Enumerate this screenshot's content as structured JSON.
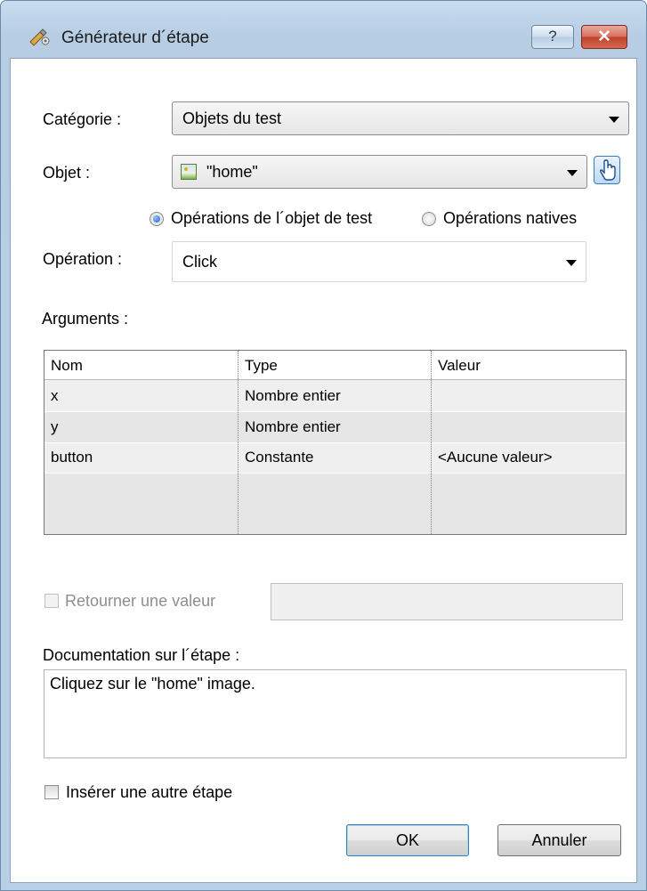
{
  "window": {
    "title": "Générateur d´étape",
    "help_label": "?",
    "close_label": "✕"
  },
  "category": {
    "label": "Catégorie :",
    "value": "Objets du test"
  },
  "object": {
    "label": "Objet :",
    "value": "\"home\"",
    "icon": "image-icon",
    "picker_icon": "pointing-hand-icon"
  },
  "operation_type": {
    "options": [
      {
        "label": "Opérations de l´objet de test",
        "selected": true
      },
      {
        "label": "Opérations natives",
        "selected": false
      }
    ]
  },
  "operation": {
    "label": "Opération :",
    "value": "Click"
  },
  "arguments": {
    "label": "Arguments :",
    "columns": [
      "Nom",
      "Type",
      "Valeur"
    ],
    "rows": [
      [
        "x",
        "Nombre entier",
        ""
      ],
      [
        "y",
        "Nombre entier",
        ""
      ],
      [
        "button",
        "Constante",
        "<Aucune valeur>"
      ]
    ]
  },
  "return_value": {
    "label": "Retourner une valeur",
    "checked": false,
    "value": ""
  },
  "documentation": {
    "label": "Documentation sur l´étape :",
    "text": "Cliquez sur le \"home\" image."
  },
  "insert_another": {
    "label": "Insérer une autre étape",
    "checked": false
  },
  "buttons": {
    "ok": "OK",
    "cancel": "Annuler"
  }
}
